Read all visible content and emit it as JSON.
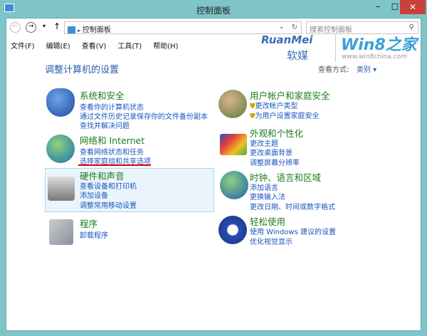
{
  "window": {
    "title": "控制面板"
  },
  "address": {
    "path": "控制面板",
    "search_placeholder": "搜索控制面板"
  },
  "menu": [
    "文件(F)",
    "编辑(E)",
    "查看(V)",
    "工具(T)",
    "帮助(H)"
  ],
  "watermark": {
    "brand1": "RuanMei",
    "brand1_cn": "软媒",
    "brand2": "Win8之家",
    "url": "www.win8china.com"
  },
  "page": {
    "heading": "调整计算机的设置",
    "view_label": "查看方式:",
    "view_value": "类别"
  },
  "left": [
    {
      "title": "系统和安全",
      "links": [
        "查看你的计算机状态",
        "通过文件历史记录保存你的文件备份副本",
        "查找并解决问题"
      ]
    },
    {
      "title": "网络和 Internet",
      "links": [
        "查看网络状态和任务",
        "选择家庭组和共享选项"
      ]
    },
    {
      "title": "硬件和声音",
      "links": [
        "查看设备和打印机",
        "添加设备",
        "调整常用移动设置"
      ]
    },
    {
      "title": "程序",
      "links": [
        "卸载程序"
      ]
    }
  ],
  "right": [
    {
      "title": "用户帐户和家庭安全",
      "links": [
        "更改帐户类型",
        "为用户设置家庭安全"
      ]
    },
    {
      "title": "外观和个性化",
      "links": [
        "更改主题",
        "更改桌面背景",
        "调整屏幕分辨率"
      ]
    },
    {
      "title": "时钟、语言和区域",
      "links": [
        "添加语言",
        "更换输入法",
        "更改日期、时间或数字格式"
      ]
    },
    {
      "title": "轻松使用",
      "links": [
        "使用 Windows 建议的设置",
        "优化视觉显示"
      ]
    }
  ]
}
